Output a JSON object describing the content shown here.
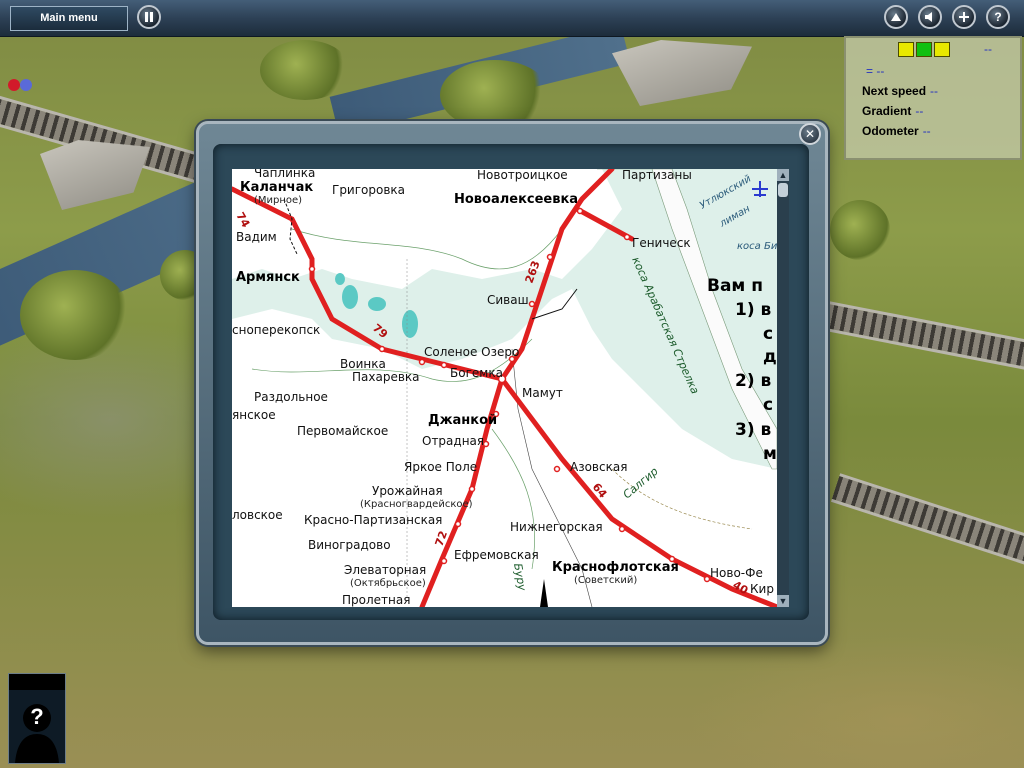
{
  "toolbar": {
    "main_menu_label": "Main menu",
    "buttons": [
      {
        "name": "camera-up-icon",
        "symbol": "triangle-up"
      },
      {
        "name": "sound-icon",
        "symbol": "speaker"
      },
      {
        "name": "add-icon",
        "symbol": "+"
      },
      {
        "name": "help-icon",
        "symbol": "?"
      }
    ],
    "pause_icon": "pause-icon"
  },
  "driver_panel": {
    "signal_aspects": [
      "#e8e800",
      "#10c010",
      "#e8e800"
    ],
    "signal_value": "--",
    "speed_readout": "= --",
    "rows": [
      {
        "label": "Next speed",
        "value": "--"
      },
      {
        "label": "Gradient",
        "value": "--"
      },
      {
        "label": "Odometer",
        "value": "--"
      }
    ]
  },
  "map": {
    "towns": {
      "chaplinka": "Чаплинка",
      "kalanchak": "Каланчак",
      "mirnoe": "(Мирное)",
      "grigorovka": "Григоровка",
      "novotroitskoe": "Новотроицкое",
      "partizany": "Партизаны",
      "novoalekseevka": "Новоалексеевка",
      "genichesk": "Геническ",
      "vadim": "Вадим",
      "armyansk": "Армянск",
      "krasnoperekopsk": "сноперекопск",
      "sivash": "Сиваш",
      "solenoe_ozero": "Соленое Озеро",
      "voinka": "Воинка",
      "pakharevka": "Пахаревка",
      "bogemka": "Богемка",
      "mamut": "Мамут",
      "razdolnoe": "Раздольное",
      "yanskoe": "янское",
      "pervomaiskoe": "Первомайское",
      "dzhankoi": "Джанкой",
      "otradnaya": "Отрадная",
      "yarkoe_pole": "Яркое Поле",
      "azovskaya": "Азовская",
      "urozhainaya": "Урожайная",
      "krasnogvardeiskoe": "(Красногвардейское)",
      "lovskoe": "ловское",
      "krasno_partizanskaya": "Красно-Партизанская",
      "nizhnegorskaya": "Нижнегорская",
      "vinogradovo": "Виноградово",
      "efremovskaya": "Ефремовская",
      "elevatornaya": "Элеваторная",
      "oktyabrskoe": "(Октябрьское)",
      "krasnoflotskaya": "Краснофлотская",
      "sovetsky": "(Советский)",
      "proletnaya": "Пролетная",
      "novo_fe": "Ново-Фе",
      "kir": "Кир",
      "utlyuksky": "Утлюкский",
      "liman": "лиман",
      "kosa_bi": "коса Би",
      "kosa_arabatskaya": "коса Арабатская Стрелка",
      "salgir": "Салгир",
      "burul": "Буру"
    },
    "km_labels": [
      "74",
      "79",
      "263",
      "72",
      "64",
      "40"
    ],
    "doc_text": {
      "heading": "Вам п",
      "item1": "1) в",
      "item1a": "с",
      "item1b": "д",
      "item2": "2) в",
      "item2a": "с",
      "item3": "3) в",
      "item3a": "м"
    }
  },
  "portrait": {
    "label": "?"
  },
  "colors": {
    "rail_line": "#e02020",
    "sea": "#def0ea",
    "land": "#ffffff",
    "toolbar": "#2d4156"
  }
}
